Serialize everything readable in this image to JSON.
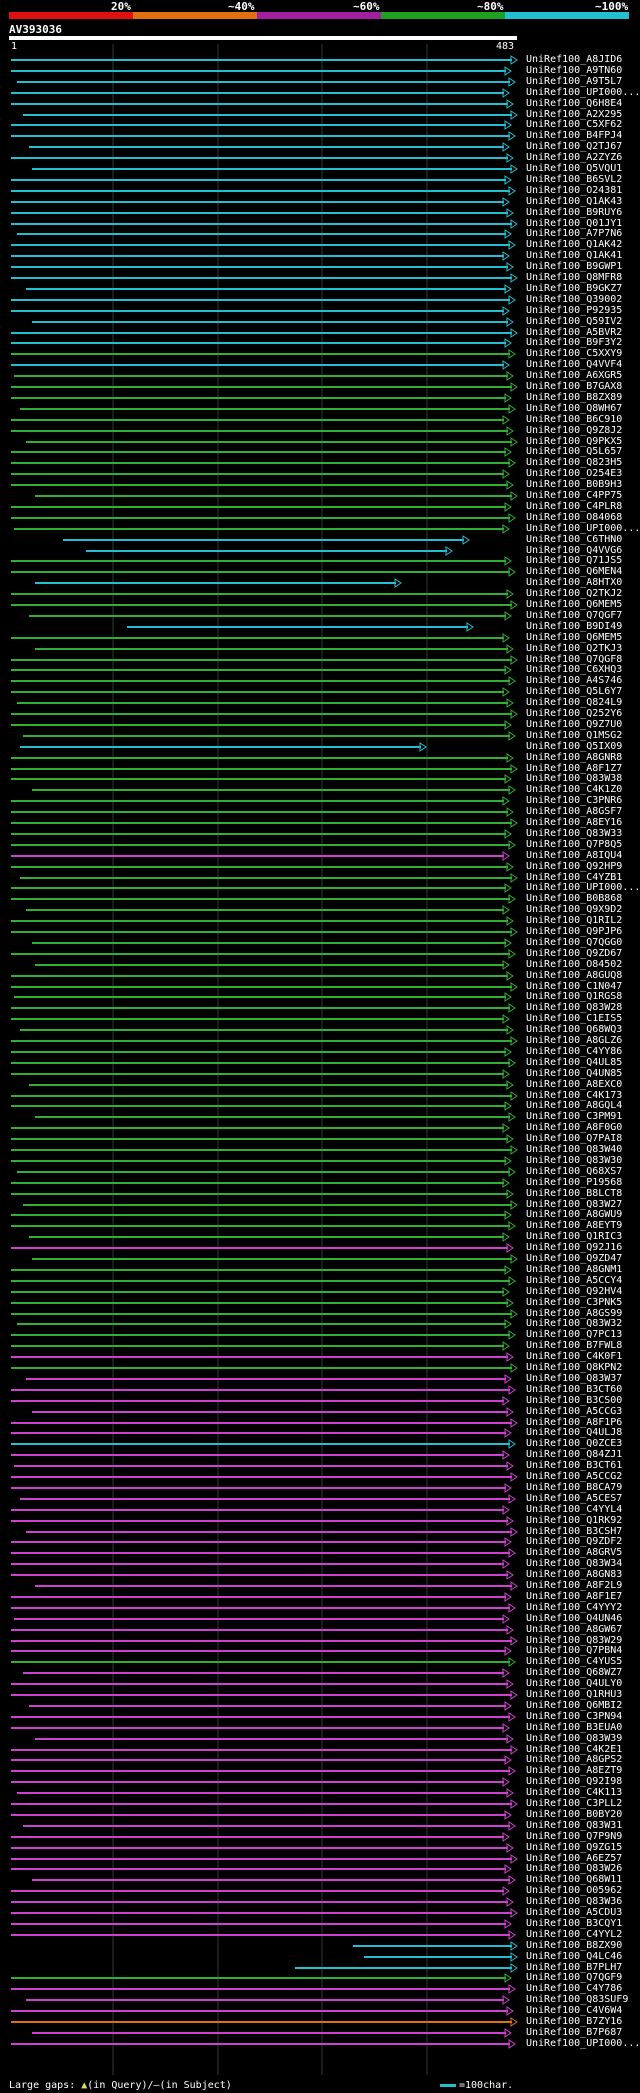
{
  "colors": {
    "red": "#e01010",
    "orange": "#e07010",
    "purple": "#c030c0",
    "green": "#30b030",
    "cyan": "#20c0d0",
    "magenta": "#d040d0",
    "grid": "#2e3a2e"
  },
  "scale": [
    {
      "label": "20%",
      "color": "#e01010"
    },
    {
      "label": "~40%",
      "color": "#e07010"
    },
    {
      "label": "~60%",
      "color": "#a020a0"
    },
    {
      "label": "~80%",
      "color": "#20a020"
    },
    {
      "label": "~100%",
      "color": "#20c0d0"
    }
  ],
  "query": {
    "id": "AV393036",
    "start": "1",
    "end": "483"
  },
  "hits": [
    {
      "label": "UniRef100_A8JID6",
      "color": "cyan"
    },
    {
      "label": "UniRef100_A9TN60",
      "color": "cyan"
    },
    {
      "label": "UniRef100_A9T5L7",
      "color": "cyan"
    },
    {
      "label": "UniRef100_UPI000...",
      "color": "cyan"
    },
    {
      "label": "UniRef100_Q6H8E4",
      "color": "cyan"
    },
    {
      "label": "UniRef100_A2X295",
      "color": "cyan"
    },
    {
      "label": "UniRef100_C5XF62",
      "color": "cyan"
    },
    {
      "label": "UniRef100_B4FPJ4",
      "color": "cyan"
    },
    {
      "label": "UniRef100_Q2TJ67",
      "color": "cyan"
    },
    {
      "label": "UniRef100_A2ZYZ6",
      "color": "cyan"
    },
    {
      "label": "UniRef100_Q5VQU1",
      "color": "cyan"
    },
    {
      "label": "UniRef100_B6SVL2",
      "color": "cyan"
    },
    {
      "label": "UniRef100_O24381",
      "color": "cyan"
    },
    {
      "label": "UniRef100_Q1AK43",
      "color": "cyan"
    },
    {
      "label": "UniRef100_B9RUY6",
      "color": "cyan"
    },
    {
      "label": "UniRef100_Q01JY1",
      "color": "cyan"
    },
    {
      "label": "UniRef100_A7P7N6",
      "color": "cyan"
    },
    {
      "label": "UniRef100_Q1AK42",
      "color": "cyan"
    },
    {
      "label": "UniRef100_Q1AK41",
      "color": "cyan"
    },
    {
      "label": "UniRef100_B9GWP1",
      "color": "cyan"
    },
    {
      "label": "UniRef100_Q8MFR8",
      "color": "cyan"
    },
    {
      "label": "UniRef100_B9GKZ7",
      "color": "cyan"
    },
    {
      "label": "UniRef100_Q39002",
      "color": "cyan"
    },
    {
      "label": "UniRef100_P92935",
      "color": "cyan"
    },
    {
      "label": "UniRef100_Q59IV2",
      "color": "cyan"
    },
    {
      "label": "UniRef100_A5BVR2",
      "color": "cyan"
    },
    {
      "label": "UniRef100_B9F3Y2",
      "color": "cyan"
    },
    {
      "label": "UniRef100_C5XXY9",
      "color": "green"
    },
    {
      "label": "UniRef100_Q4VVF4",
      "color": "cyan"
    },
    {
      "label": "UniRef100_A6XGR5",
      "color": "green"
    },
    {
      "label": "UniRef100_B7GAX8",
      "color": "green"
    },
    {
      "label": "UniRef100_B8ZX89",
      "color": "green"
    },
    {
      "label": "UniRef100_Q8WH67",
      "color": "green"
    },
    {
      "label": "UniRef100_B6C910",
      "color": "green"
    },
    {
      "label": "UniRef100_Q9Z8J2",
      "color": "green"
    },
    {
      "label": "UniRef100_Q9PKX5",
      "color": "green"
    },
    {
      "label": "UniRef100_Q5L657",
      "color": "green"
    },
    {
      "label": "UniRef100_Q823H5",
      "color": "green"
    },
    {
      "label": "UniRef100_O254E3",
      "color": "green"
    },
    {
      "label": "UniRef100_B0B9H3",
      "color": "green"
    },
    {
      "label": "UniRef100_C4PP75",
      "color": "green"
    },
    {
      "label": "UniRef100_C4PLR8",
      "color": "green"
    },
    {
      "label": "UniRef100_O84068",
      "color": "green"
    },
    {
      "label": "UniRef100_UPI000...",
      "color": "green"
    },
    {
      "label": "UniRef100_C6THN0",
      "color": "cyan"
    },
    {
      "label": "UniRef100_Q4VVG6",
      "color": "cyan"
    },
    {
      "label": "UniRef100_Q71JS5",
      "color": "green"
    },
    {
      "label": "UniRef100_Q6MEN4",
      "color": "green"
    },
    {
      "label": "UniRef100_A8HTX0",
      "color": "cyan"
    },
    {
      "label": "UniRef100_Q2TKJ2",
      "color": "green"
    },
    {
      "label": "UniRef100_Q6MEM5",
      "color": "green"
    },
    {
      "label": "UniRef100_Q7QGF7",
      "color": "green"
    },
    {
      "label": "UniRef100_B9DI49",
      "color": "cyan"
    },
    {
      "label": "UniRef100_Q6MEM5",
      "color": "green"
    },
    {
      "label": "UniRef100_Q2TKJ3",
      "color": "green"
    },
    {
      "label": "UniRef100_Q7QGF8",
      "color": "green"
    },
    {
      "label": "UniRef100_C6XHQ3",
      "color": "green"
    },
    {
      "label": "UniRef100_A4S746",
      "color": "green"
    },
    {
      "label": "UniRef100_Q5L6Y7",
      "color": "green"
    },
    {
      "label": "UniRef100_Q824L9",
      "color": "green"
    },
    {
      "label": "UniRef100_Q252Y6",
      "color": "green"
    },
    {
      "label": "UniRef100_Q9Z7U0",
      "color": "green"
    },
    {
      "label": "UniRef100_Q1MSG2",
      "color": "green"
    },
    {
      "label": "UniRef100_Q5IX09",
      "color": "cyan"
    },
    {
      "label": "UniRef100_A8GNR8",
      "color": "green"
    },
    {
      "label": "UniRef100_A8F1Z7",
      "color": "green"
    },
    {
      "label": "UniRef100_Q83W38",
      "color": "green"
    },
    {
      "label": "UniRef100_C4K1Z0",
      "color": "green"
    },
    {
      "label": "UniRef100_C3PNR6",
      "color": "green"
    },
    {
      "label": "UniRef100_A8GSF7",
      "color": "green"
    },
    {
      "label": "UniRef100_A8EY16",
      "color": "green"
    },
    {
      "label": "UniRef100_Q83W33",
      "color": "green"
    },
    {
      "label": "UniRef100_Q7P8Q5",
      "color": "green"
    },
    {
      "label": "UniRef100_A8IQU4",
      "color": "magenta"
    },
    {
      "label": "UniRef100_Q92HP9",
      "color": "green"
    },
    {
      "label": "UniRef100_C4YZB1",
      "color": "green"
    },
    {
      "label": "UniRef100_UPI000...",
      "color": "green"
    },
    {
      "label": "UniRef100_B0B868",
      "color": "green"
    },
    {
      "label": "UniRef100_Q9X9D2",
      "color": "green"
    },
    {
      "label": "UniRef100_Q1RIL2",
      "color": "green"
    },
    {
      "label": "UniRef100_Q9PJP6",
      "color": "green"
    },
    {
      "label": "UniRef100_Q7QGG0",
      "color": "green"
    },
    {
      "label": "UniRef100_Q9ZD67",
      "color": "green"
    },
    {
      "label": "UniRef100_O84502",
      "color": "green"
    },
    {
      "label": "UniRef100_A8GUQ8",
      "color": "green"
    },
    {
      "label": "UniRef100_C1N047",
      "color": "green"
    },
    {
      "label": "UniRef100_Q1RGS8",
      "color": "green"
    },
    {
      "label": "UniRef100_Q83W28",
      "color": "green"
    },
    {
      "label": "UniRef100_C1EIS5",
      "color": "green"
    },
    {
      "label": "UniRef100_Q68WQ3",
      "color": "green"
    },
    {
      "label": "UniRef100_A8GLZ6",
      "color": "green"
    },
    {
      "label": "UniRef100_C4YY86",
      "color": "green"
    },
    {
      "label": "UniRef100_Q4UL85",
      "color": "green"
    },
    {
      "label": "UniRef100_Q4UN85",
      "color": "green"
    },
    {
      "label": "UniRef100_A8EXC0",
      "color": "green"
    },
    {
      "label": "UniRef100_C4K173",
      "color": "green"
    },
    {
      "label": "UniRef100_A8GQL4",
      "color": "green"
    },
    {
      "label": "UniRef100_C3PM91",
      "color": "green"
    },
    {
      "label": "UniRef100_A8F0G0",
      "color": "green"
    },
    {
      "label": "UniRef100_Q7PAI8",
      "color": "green"
    },
    {
      "label": "UniRef100_Q83W40",
      "color": "green"
    },
    {
      "label": "UniRef100_Q83W30",
      "color": "green"
    },
    {
      "label": "UniRef100_Q68XS7",
      "color": "green"
    },
    {
      "label": "UniRef100_P19568",
      "color": "green"
    },
    {
      "label": "UniRef100_B8LCT8",
      "color": "green"
    },
    {
      "label": "UniRef100_Q83W27",
      "color": "green"
    },
    {
      "label": "UniRef100_A8GWU9",
      "color": "green"
    },
    {
      "label": "UniRef100_A8EYT9",
      "color": "green"
    },
    {
      "label": "UniRef100_Q1RIC3",
      "color": "green"
    },
    {
      "label": "UniRef100_Q92J16",
      "color": "magenta"
    },
    {
      "label": "UniRef100_Q9ZD47",
      "color": "green"
    },
    {
      "label": "UniRef100_A8GNM1",
      "color": "green"
    },
    {
      "label": "UniRef100_A5CCY4",
      "color": "green"
    },
    {
      "label": "UniRef100_Q92HV4",
      "color": "green"
    },
    {
      "label": "UniRef100_C3PNK5",
      "color": "green"
    },
    {
      "label": "UniRef100_A8GS99",
      "color": "green"
    },
    {
      "label": "UniRef100_Q83W32",
      "color": "green"
    },
    {
      "label": "UniRef100_Q7PC13",
      "color": "green"
    },
    {
      "label": "UniRef100_B7FWL8",
      "color": "green"
    },
    {
      "label": "UniRef100_C4K0F1",
      "color": "magenta"
    },
    {
      "label": "UniRef100_Q8KPN2",
      "color": "green"
    },
    {
      "label": "UniRef100_Q83W37",
      "color": "magenta"
    },
    {
      "label": "UniRef100_B3CT60",
      "color": "magenta"
    },
    {
      "label": "UniRef100_B3CS00",
      "color": "magenta"
    },
    {
      "label": "UniRef100_A5CCG3",
      "color": "magenta"
    },
    {
      "label": "UniRef100_A8F1P6",
      "color": "magenta"
    },
    {
      "label": "UniRef100_Q4ULJ8",
      "color": "magenta"
    },
    {
      "label": "UniRef100_Q0ZCE3",
      "color": "cyan"
    },
    {
      "label": "UniRef100_Q84ZJ1",
      "color": "magenta"
    },
    {
      "label": "UniRef100_B3CT61",
      "color": "magenta"
    },
    {
      "label": "UniRef100_A5CCG2",
      "color": "magenta"
    },
    {
      "label": "UniRef100_B8CA79",
      "color": "magenta"
    },
    {
      "label": "UniRef100_A5CES7",
      "color": "magenta"
    },
    {
      "label": "UniRef100_C4YYL4",
      "color": "magenta"
    },
    {
      "label": "UniRef100_Q1RK92",
      "color": "magenta"
    },
    {
      "label": "UniRef100_B3CSH7",
      "color": "magenta"
    },
    {
      "label": "UniRef100_Q9ZDF2",
      "color": "magenta"
    },
    {
      "label": "UniRef100_A8GRV5",
      "color": "magenta"
    },
    {
      "label": "UniRef100_Q83W34",
      "color": "magenta"
    },
    {
      "label": "UniRef100_A8GN83",
      "color": "magenta"
    },
    {
      "label": "UniRef100_A8F2L9",
      "color": "magenta"
    },
    {
      "label": "UniRef100_A8F1E7",
      "color": "magenta"
    },
    {
      "label": "UniRef100_C4YYY2",
      "color": "magenta"
    },
    {
      "label": "UniRef100_Q4UN46",
      "color": "magenta"
    },
    {
      "label": "UniRef100_A8GW67",
      "color": "magenta"
    },
    {
      "label": "UniRef100_Q83W29",
      "color": "magenta"
    },
    {
      "label": "UniRef100_Q7PBN4",
      "color": "magenta"
    },
    {
      "label": "UniRef100_C4YUS5",
      "color": "green"
    },
    {
      "label": "UniRef100_Q68WZ7",
      "color": "magenta"
    },
    {
      "label": "UniRef100_Q4ULY0",
      "color": "magenta"
    },
    {
      "label": "UniRef100_Q1RHU3",
      "color": "magenta"
    },
    {
      "label": "UniRef100_Q6MBI2",
      "color": "magenta"
    },
    {
      "label": "UniRef100_C3PN94",
      "color": "magenta"
    },
    {
      "label": "UniRef100_B3EUA0",
      "color": "magenta"
    },
    {
      "label": "UniRef100_Q83W39",
      "color": "magenta"
    },
    {
      "label": "UniRef100_C4K2E1",
      "color": "magenta"
    },
    {
      "label": "UniRef100_A8GPS2",
      "color": "magenta"
    },
    {
      "label": "UniRef100_A8EZT9",
      "color": "magenta"
    },
    {
      "label": "UniRef100_Q92I98",
      "color": "magenta"
    },
    {
      "label": "UniRef100_C4K113",
      "color": "magenta"
    },
    {
      "label": "UniRef100_C3PLL2",
      "color": "magenta"
    },
    {
      "label": "UniRef100_B0BY20",
      "color": "magenta"
    },
    {
      "label": "UniRef100_Q83W31",
      "color": "magenta"
    },
    {
      "label": "UniRef100_Q7P9N9",
      "color": "magenta"
    },
    {
      "label": "UniRef100_Q9ZG15",
      "color": "magenta"
    },
    {
      "label": "UniRef100_A6EZ57",
      "color": "magenta"
    },
    {
      "label": "UniRef100_Q83W26",
      "color": "magenta"
    },
    {
      "label": "UniRef100_Q68W11",
      "color": "magenta"
    },
    {
      "label": "UniRef100_O05962",
      "color": "magenta"
    },
    {
      "label": "UniRef100_Q83W36",
      "color": "magenta"
    },
    {
      "label": "UniRef100_A5CDU3",
      "color": "magenta"
    },
    {
      "label": "UniRef100_B3CQY1",
      "color": "magenta"
    },
    {
      "label": "UniRef100_C4YYL2",
      "color": "magenta"
    },
    {
      "label": "UniRef100_B8ZX90",
      "color": "cyan"
    },
    {
      "label": "UniRef100_Q4LC46",
      "color": "cyan"
    },
    {
      "label": "UniRef100_B7PLH7",
      "color": "cyan"
    },
    {
      "label": "UniRef100_Q7QGF9",
      "color": "green"
    },
    {
      "label": "UniRef100_C4Y786",
      "color": "magenta"
    },
    {
      "label": "UniRef100_Q83SUF9",
      "color": "magenta"
    },
    {
      "label": "UniRef100_C4V6W4",
      "color": "magenta"
    },
    {
      "label": "UniRef100_B7ZY16",
      "color": "orange"
    },
    {
      "label": "UniRef100_B7P687",
      "color": "magenta"
    },
    {
      "label": "UniRef100_UPI000...",
      "color": "magenta"
    }
  ],
  "footer": {
    "gaps_prefix": "Large gaps: ",
    "gaps_query": "(in Query)/",
    "gaps_subject": "(in Subject)",
    "legend_text": "=100char."
  }
}
